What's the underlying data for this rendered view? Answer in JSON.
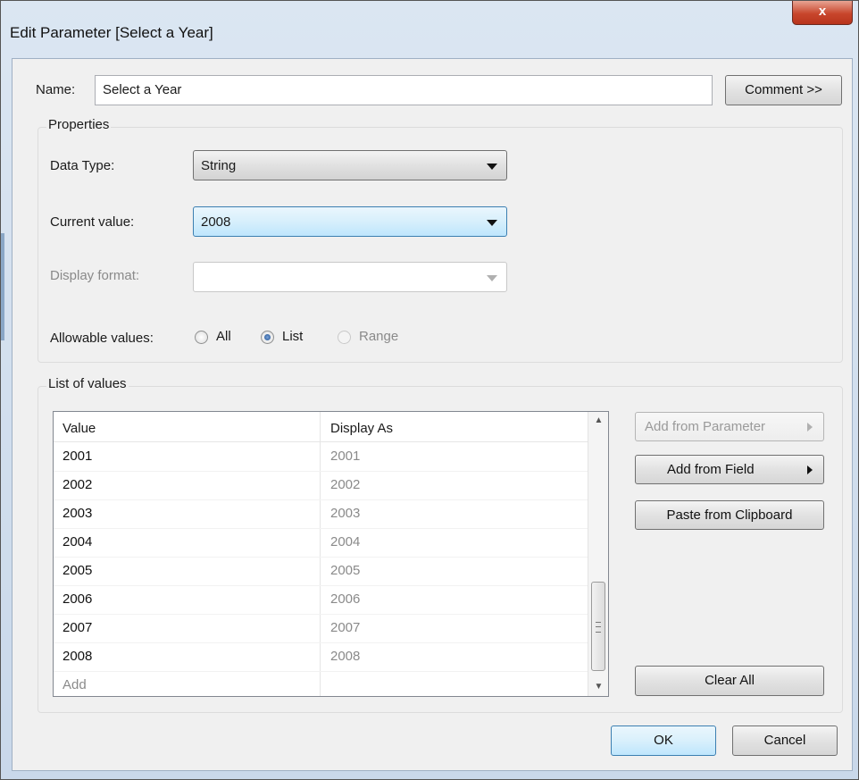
{
  "window": {
    "title": "Edit Parameter [Select a Year]",
    "close_glyph": "x"
  },
  "name_row": {
    "label": "Name:",
    "value": "Select a Year",
    "comment_button": "Comment >>"
  },
  "properties": {
    "title": "Properties",
    "data_type": {
      "label": "Data Type:",
      "value": "String"
    },
    "current_value": {
      "label": "Current value:",
      "value": "2008"
    },
    "display_format": {
      "label": "Display format:",
      "value": ""
    },
    "allowable": {
      "label": "Allowable values:",
      "options": [
        "All",
        "List",
        "Range"
      ],
      "selected": "List"
    }
  },
  "list_of_values": {
    "title": "List of values",
    "columns": [
      "Value",
      "Display As"
    ],
    "rows": [
      {
        "value": "2001",
        "display": "2001"
      },
      {
        "value": "2002",
        "display": "2002"
      },
      {
        "value": "2003",
        "display": "2003"
      },
      {
        "value": "2004",
        "display": "2004"
      },
      {
        "value": "2005",
        "display": "2005"
      },
      {
        "value": "2006",
        "display": "2006"
      },
      {
        "value": "2007",
        "display": "2007"
      },
      {
        "value": "2008",
        "display": "2008"
      }
    ],
    "add_placeholder": "Add",
    "buttons": {
      "add_from_parameter": "Add from Parameter",
      "add_from_field": "Add from Field",
      "paste_from_clipboard": "Paste from Clipboard",
      "clear_all": "Clear All"
    }
  },
  "footer": {
    "ok": "OK",
    "cancel": "Cancel"
  },
  "colors": {
    "accent": "#3c7fb1",
    "close": "#c8462c",
    "disabled_text": "#8a8a8a"
  }
}
